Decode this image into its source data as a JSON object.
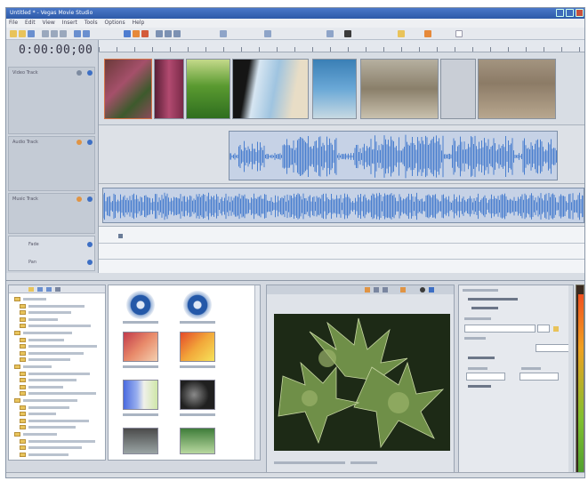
{
  "window": {
    "title": "Untitled * - Vegas Movie Studio"
  },
  "menu": {
    "items": [
      "File",
      "Edit",
      "View",
      "Insert",
      "Tools",
      "Options",
      "Help"
    ]
  },
  "timeline": {
    "timecode": "0:00:00;00",
    "tracks": [
      {
        "type": "video",
        "label": "Video Track"
      },
      {
        "type": "audio",
        "label": "Audio Track"
      },
      {
        "type": "audio",
        "label": "Music Track"
      }
    ],
    "envelope_labels": [
      "Fade",
      "Pan"
    ]
  },
  "colors": {
    "waveform": "#4a7fcf",
    "accent": "#2d5aa8"
  },
  "icons": [
    "folder-icon",
    "play-icon",
    "stop-icon",
    "record-icon",
    "cursor-icon",
    "scissors-icon"
  ]
}
